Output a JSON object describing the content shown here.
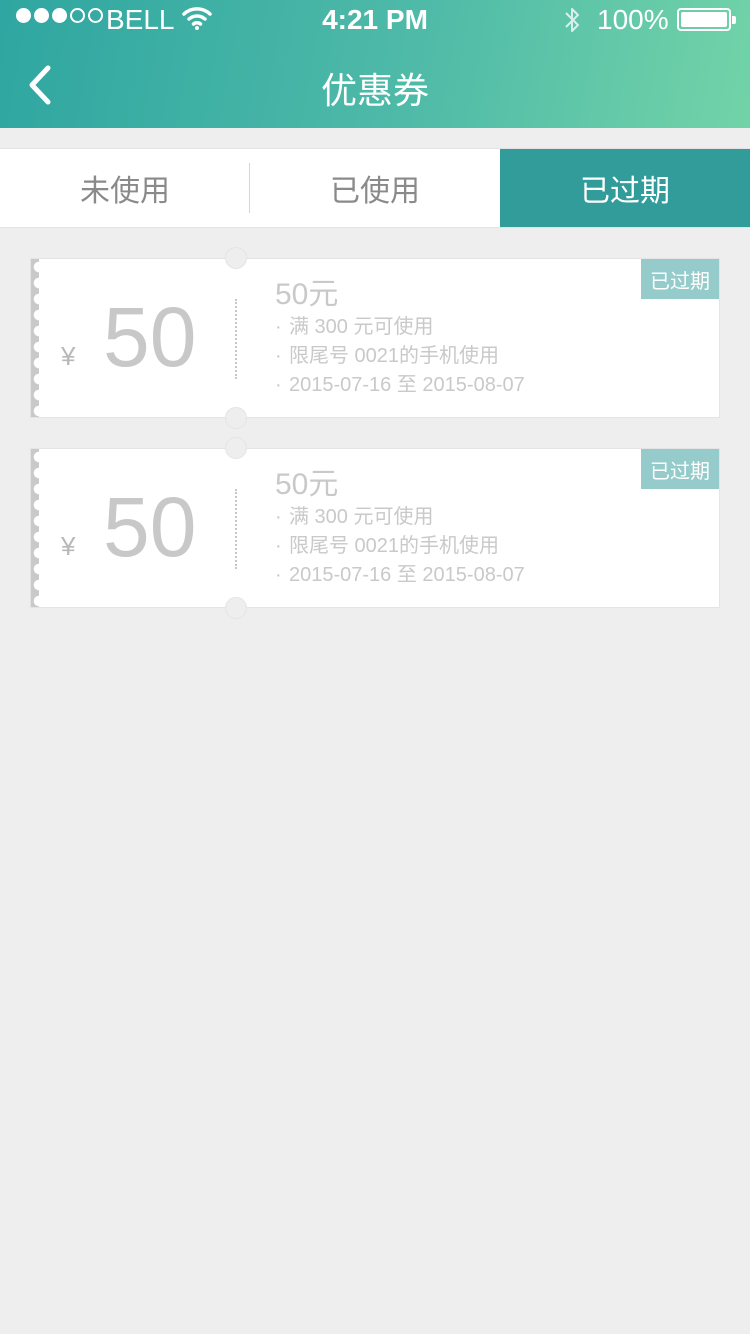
{
  "status_bar": {
    "carrier": "BELL",
    "time": "4:21 PM",
    "battery": "100%",
    "signal_bars_filled": 3,
    "signal_bars_total": 5
  },
  "nav": {
    "title": "优惠券",
    "back_icon": "chevron-left-icon"
  },
  "tabs": [
    {
      "label": "未使用",
      "active": false
    },
    {
      "label": "已使用",
      "active": false
    },
    {
      "label": "已过期",
      "active": true
    }
  ],
  "colors": {
    "header_start": "#2fa6a1",
    "header_end": "#72d3a8",
    "active_tab": "#319c99",
    "badge": "#95cccb",
    "background": "#eeeeee"
  },
  "coupons": [
    {
      "currency": "¥",
      "amount": "50",
      "title": "50元",
      "lines": [
        "满 300 元可使用",
        "限尾号 0021的手机使用",
        "2015-07-16 至 2015-08-07"
      ],
      "badge": "已过期"
    },
    {
      "currency": "¥",
      "amount": "50",
      "title": "50元",
      "lines": [
        "满 300 元可使用",
        "限尾号 0021的手机使用",
        "2015-07-16 至 2015-08-07"
      ],
      "badge": "已过期"
    }
  ]
}
